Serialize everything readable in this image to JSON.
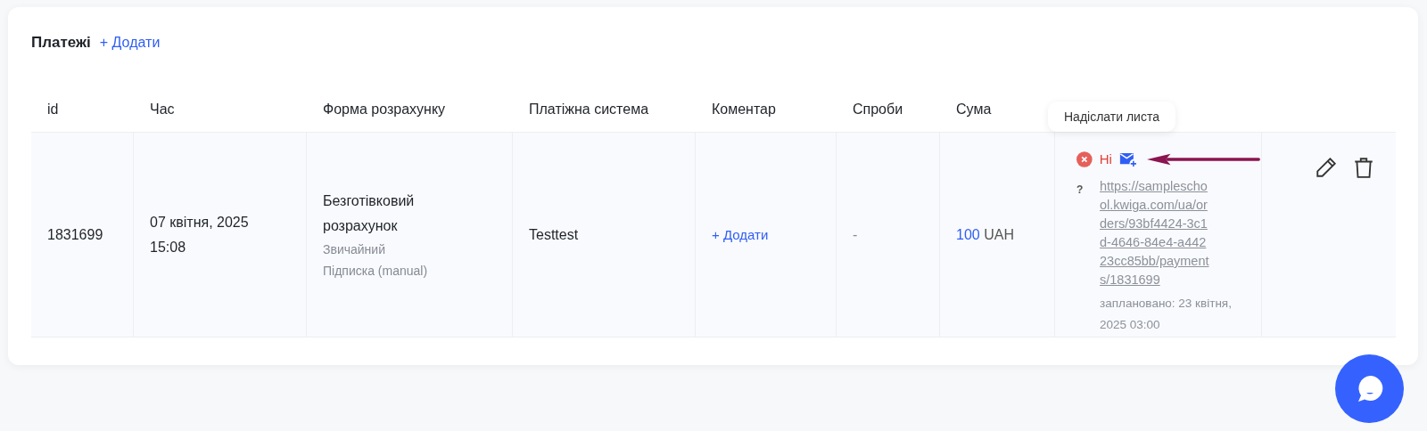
{
  "section": {
    "title": "Платежі",
    "add_link": "+ Додати"
  },
  "table": {
    "columns": [
      "id",
      "Час",
      "Форма розрахунку",
      "Платіжна система",
      "Коментар",
      "Спроби",
      "Сума"
    ],
    "rows": [
      {
        "id": "1831699",
        "time": [
          "07 квітня, 2025",
          "15:08"
        ],
        "payment_form": {
          "title": "Безготівковий розрахунок",
          "details": [
            "Звичайний",
            "Підписка (manual)"
          ]
        },
        "payment_system": "Testtest",
        "comment_link": "+ Додати",
        "attempts": "-",
        "amount": {
          "value": "100",
          "currency": "UAH"
        },
        "status": {
          "sent": false,
          "label": "Ні",
          "help": "?",
          "url": "https://sampleschool.kwiga.com/ua/orders/93bf4424-3c1d-4646-84e4-a44223cc85bb/payments/1831699",
          "scheduled": "заплановано: 23 квітня, 2025 03:00"
        }
      }
    ]
  },
  "tooltip": "Надіслати листа"
}
